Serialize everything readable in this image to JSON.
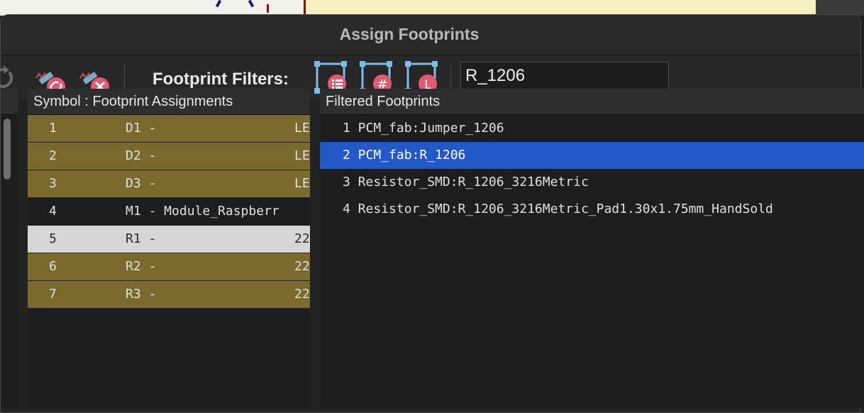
{
  "dialog": {
    "title": "Assign Footprints"
  },
  "toolbar": {
    "filters_label": "Footprint Filters:",
    "filter_value": "R_1206",
    "buttons": [
      {
        "icon": "refresh-icon"
      },
      {
        "icon": "link-footprint-icon"
      },
      {
        "icon": "unlink-footprint-icon"
      },
      {
        "icon": "filter-by-keyword-icon"
      },
      {
        "icon": "filter-by-pin-count-icon"
      },
      {
        "icon": "filter-by-library-icon"
      }
    ]
  },
  "assignments": {
    "header": "Symbol : Footprint Assignments",
    "rows": [
      {
        "num": "1",
        "ref": "D1 -",
        "fp": "LE"
      },
      {
        "num": "2",
        "ref": "D2 -",
        "fp": "LE"
      },
      {
        "num": "3",
        "ref": "D3 -",
        "fp": "LE"
      },
      {
        "num": "4",
        "ref": "M1 - Module_Raspberr",
        "fp": ""
      },
      {
        "num": "5",
        "ref": "R1 -",
        "fp": "22"
      },
      {
        "num": "6",
        "ref": "R2 -",
        "fp": "22"
      },
      {
        "num": "7",
        "ref": "R3 -",
        "fp": "22"
      }
    ]
  },
  "filtered": {
    "header": "Filtered Footprints",
    "rows": [
      {
        "text": "1 PCM_fab:Jumper_1206"
      },
      {
        "text": "2 PCM_fab:R_1206"
      },
      {
        "text": "3 Resistor_SMD:R_1206_3216Metric"
      },
      {
        "text": "4 Resistor_SMD:R_1206_3216Metric_Pad1.30x1.75mm_HandSold"
      }
    ]
  },
  "colors": {
    "unassigned_row": "#7a6a2e",
    "selected_row_blue": "#2358c8",
    "selected_row_gray": "#d6d6d6"
  }
}
